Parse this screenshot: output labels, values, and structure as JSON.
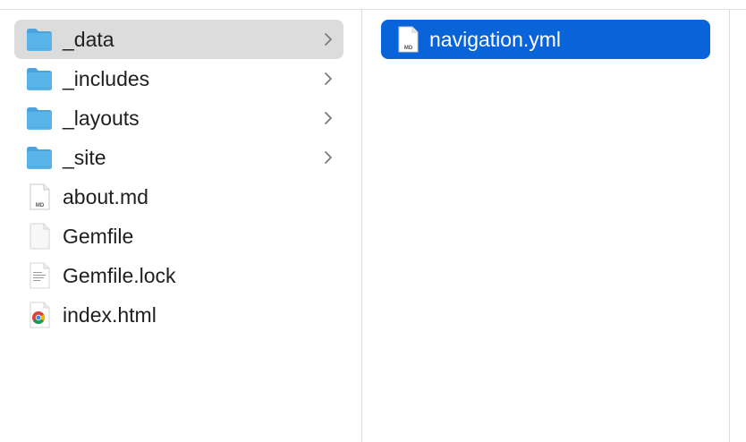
{
  "column1": {
    "items": [
      {
        "name": "_data",
        "type": "folder",
        "selected": true
      },
      {
        "name": "_includes",
        "type": "folder",
        "selected": false
      },
      {
        "name": "_layouts",
        "type": "folder",
        "selected": false
      },
      {
        "name": "_site",
        "type": "folder",
        "selected": false
      },
      {
        "name": "about.md",
        "type": "md-file",
        "badge": "MD",
        "selected": false
      },
      {
        "name": "Gemfile",
        "type": "blank-file",
        "selected": false
      },
      {
        "name": "Gemfile.lock",
        "type": "text-file",
        "selected": false
      },
      {
        "name": "index.html",
        "type": "html-file",
        "selected": false
      }
    ]
  },
  "column2": {
    "items": [
      {
        "name": "navigation.yml",
        "type": "md-file",
        "badge": "MD",
        "selected": true
      }
    ]
  },
  "colors": {
    "folder": "#5ab4ea",
    "folder_tab": "#4aa3dc",
    "selection_active": "#0a64d9",
    "selection_inactive": "#dcdcdc"
  }
}
